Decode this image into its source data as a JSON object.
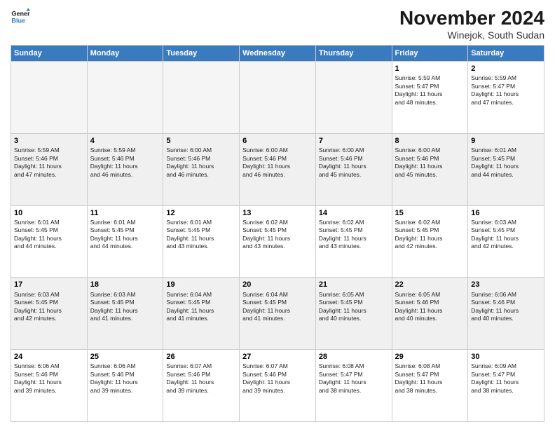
{
  "header": {
    "logo_line1": "General",
    "logo_line2": "Blue",
    "month_title": "November 2024",
    "location": "Winejok, South Sudan"
  },
  "weekdays": [
    "Sunday",
    "Monday",
    "Tuesday",
    "Wednesday",
    "Thursday",
    "Friday",
    "Saturday"
  ],
  "weeks": [
    [
      {
        "day": "",
        "info": ""
      },
      {
        "day": "",
        "info": ""
      },
      {
        "day": "",
        "info": ""
      },
      {
        "day": "",
        "info": ""
      },
      {
        "day": "",
        "info": ""
      },
      {
        "day": "1",
        "info": "Sunrise: 5:59 AM\nSunset: 5:47 PM\nDaylight: 11 hours\nand 48 minutes."
      },
      {
        "day": "2",
        "info": "Sunrise: 5:59 AM\nSunset: 5:47 PM\nDaylight: 11 hours\nand 47 minutes."
      }
    ],
    [
      {
        "day": "3",
        "info": "Sunrise: 5:59 AM\nSunset: 5:46 PM\nDaylight: 11 hours\nand 47 minutes."
      },
      {
        "day": "4",
        "info": "Sunrise: 5:59 AM\nSunset: 5:46 PM\nDaylight: 11 hours\nand 46 minutes."
      },
      {
        "day": "5",
        "info": "Sunrise: 6:00 AM\nSunset: 5:46 PM\nDaylight: 11 hours\nand 46 minutes."
      },
      {
        "day": "6",
        "info": "Sunrise: 6:00 AM\nSunset: 5:46 PM\nDaylight: 11 hours\nand 46 minutes."
      },
      {
        "day": "7",
        "info": "Sunrise: 6:00 AM\nSunset: 5:46 PM\nDaylight: 11 hours\nand 45 minutes."
      },
      {
        "day": "8",
        "info": "Sunrise: 6:00 AM\nSunset: 5:46 PM\nDaylight: 11 hours\nand 45 minutes."
      },
      {
        "day": "9",
        "info": "Sunrise: 6:01 AM\nSunset: 5:45 PM\nDaylight: 11 hours\nand 44 minutes."
      }
    ],
    [
      {
        "day": "10",
        "info": "Sunrise: 6:01 AM\nSunset: 5:45 PM\nDaylight: 11 hours\nand 44 minutes."
      },
      {
        "day": "11",
        "info": "Sunrise: 6:01 AM\nSunset: 5:45 PM\nDaylight: 11 hours\nand 44 minutes."
      },
      {
        "day": "12",
        "info": "Sunrise: 6:01 AM\nSunset: 5:45 PM\nDaylight: 11 hours\nand 43 minutes."
      },
      {
        "day": "13",
        "info": "Sunrise: 6:02 AM\nSunset: 5:45 PM\nDaylight: 11 hours\nand 43 minutes."
      },
      {
        "day": "14",
        "info": "Sunrise: 6:02 AM\nSunset: 5:45 PM\nDaylight: 11 hours\nand 43 minutes."
      },
      {
        "day": "15",
        "info": "Sunrise: 6:02 AM\nSunset: 5:45 PM\nDaylight: 11 hours\nand 42 minutes."
      },
      {
        "day": "16",
        "info": "Sunrise: 6:03 AM\nSunset: 5:45 PM\nDaylight: 11 hours\nand 42 minutes."
      }
    ],
    [
      {
        "day": "17",
        "info": "Sunrise: 6:03 AM\nSunset: 5:45 PM\nDaylight: 11 hours\nand 42 minutes."
      },
      {
        "day": "18",
        "info": "Sunrise: 6:03 AM\nSunset: 5:45 PM\nDaylight: 11 hours\nand 41 minutes."
      },
      {
        "day": "19",
        "info": "Sunrise: 6:04 AM\nSunset: 5:45 PM\nDaylight: 11 hours\nand 41 minutes."
      },
      {
        "day": "20",
        "info": "Sunrise: 6:04 AM\nSunset: 5:45 PM\nDaylight: 11 hours\nand 41 minutes."
      },
      {
        "day": "21",
        "info": "Sunrise: 6:05 AM\nSunset: 5:45 PM\nDaylight: 11 hours\nand 40 minutes."
      },
      {
        "day": "22",
        "info": "Sunrise: 6:05 AM\nSunset: 5:46 PM\nDaylight: 11 hours\nand 40 minutes."
      },
      {
        "day": "23",
        "info": "Sunrise: 6:06 AM\nSunset: 5:46 PM\nDaylight: 11 hours\nand 40 minutes."
      }
    ],
    [
      {
        "day": "24",
        "info": "Sunrise: 6:06 AM\nSunset: 5:46 PM\nDaylight: 11 hours\nand 39 minutes."
      },
      {
        "day": "25",
        "info": "Sunrise: 6:06 AM\nSunset: 5:46 PM\nDaylight: 11 hours\nand 39 minutes."
      },
      {
        "day": "26",
        "info": "Sunrise: 6:07 AM\nSunset: 5:46 PM\nDaylight: 11 hours\nand 39 minutes."
      },
      {
        "day": "27",
        "info": "Sunrise: 6:07 AM\nSunset: 5:46 PM\nDaylight: 11 hours\nand 39 minutes."
      },
      {
        "day": "28",
        "info": "Sunrise: 6:08 AM\nSunset: 5:47 PM\nDaylight: 11 hours\nand 38 minutes."
      },
      {
        "day": "29",
        "info": "Sunrise: 6:08 AM\nSunset: 5:47 PM\nDaylight: 11 hours\nand 38 minutes."
      },
      {
        "day": "30",
        "info": "Sunrise: 6:09 AM\nSunset: 5:47 PM\nDaylight: 11 hours\nand 38 minutes."
      }
    ]
  ]
}
